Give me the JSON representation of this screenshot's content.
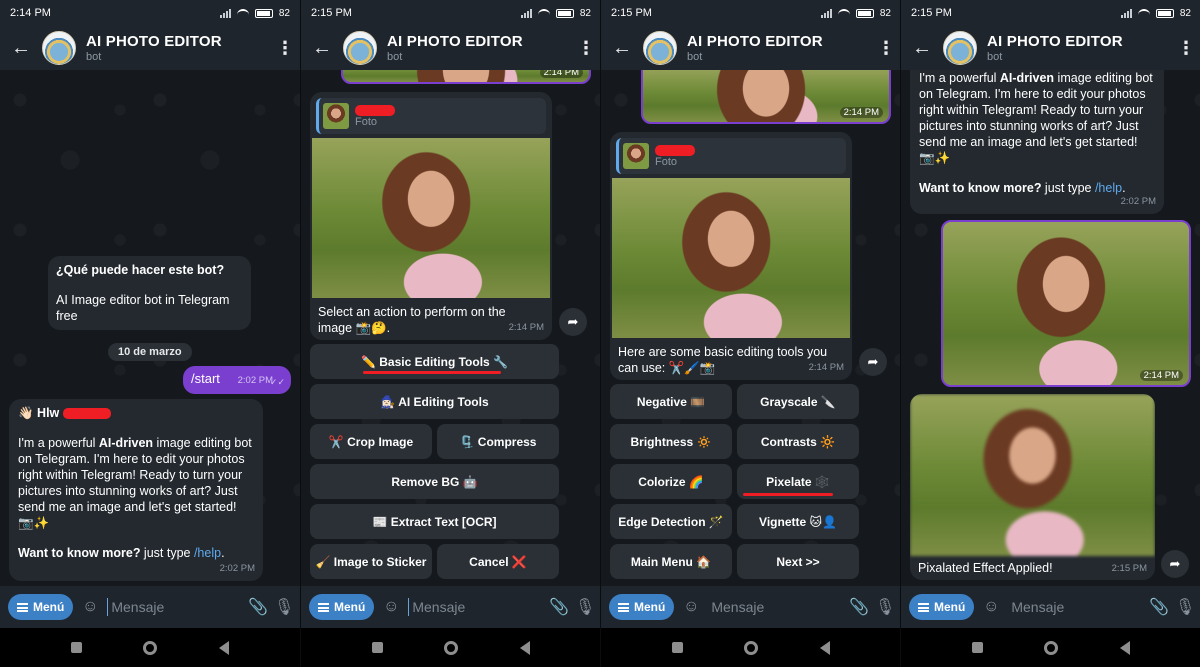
{
  "status": {
    "time": "2:14 PM",
    "time_b": "2:15 PM",
    "battery": "82"
  },
  "header": {
    "title": "AI PHOTO EDITOR",
    "subtitle": "bot"
  },
  "input": {
    "menu_label": "Menú",
    "placeholder": "Mensaje"
  },
  "screen1": {
    "info_title": "¿Qué puede hacer este bot?",
    "info_body": "AI Image editor bot in Telegram free",
    "date_pill": "10 de marzo",
    "start_cmd": "/start",
    "start_time": "2:02 PM",
    "greet": "👋🏻 Hlw",
    "msg_pre": "I'm a powerful ",
    "msg_bold": "AI-driven",
    "msg_post": " image editing bot on Telegram. I'm here to edit your photos right within Telegram! Ready to turn your pictures into stunning works of art? Just send me an image and let's get started! 📷✨",
    "more_bold": "Want to know more?",
    "more_text": " just type ",
    "more_link": "/help",
    "more_end": ".",
    "msg_time": "2:02 PM"
  },
  "screen2": {
    "top_time": "2:14 PM",
    "reply_sub": "Foto",
    "caption": "Select an action to perform on the image 📸🤔.",
    "caption_time": "2:14 PM",
    "buttons": {
      "basic": "✏️ Basic Editing Tools 🔧",
      "ai": "🧙🏻‍♀️ AI Editing Tools",
      "crop": "✂️ Crop Image",
      "compress": "🗜️ Compress",
      "removebg": "Remove BG 🤖",
      "ocr": "📰 Extract Text [OCR]",
      "sticker": "🧹 Image to Sticker",
      "cancel": "Cancel ❌"
    }
  },
  "screen3": {
    "top_time": "2:14 PM",
    "reply_sub": "Foto",
    "caption": "Here are some basic editing tools you can use: ✂️🖌️📸",
    "caption_time": "2:14 PM",
    "buttons": {
      "negative": "Negative 🎞️",
      "grayscale": "Grayscale 🔪",
      "brightness": "Brightness 🔅",
      "contrasts": "Contrasts 🔆",
      "colorize": "Colorize 🌈",
      "pixelate": "Pixelate 🕸️",
      "edge": "Edge Detection 🪄",
      "vignette": "Vignette 🐱👤",
      "mainmenu": "Main Menu 🏠",
      "next": "Next >>"
    }
  },
  "screen4": {
    "msg_pre": "I'm a powerful ",
    "msg_bold": "AI-driven",
    "msg_post": " image editing bot on Telegram. I'm here to edit your photos right within Telegram! Ready to turn your pictures into stunning works of art? Just send me an image and let's get started! 📷✨",
    "more_bold": "Want to know more?",
    "more_text": " just type ",
    "more_link": "/help",
    "more_end": ".",
    "msg_time": "2:02 PM",
    "photo_time": "2:14 PM",
    "result_caption": "Pixalated Effect Applied!",
    "result_time": "2:15 PM"
  },
  "colors": {
    "accent": "#3c80c6",
    "outgoing": "#7b3fd0",
    "redaction": "#ef1e24",
    "link": "#5fa9ec"
  }
}
